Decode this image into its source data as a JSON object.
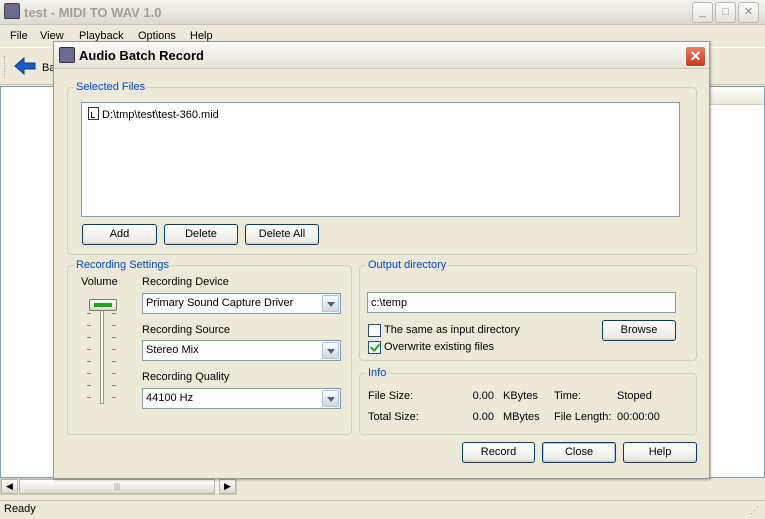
{
  "main_window": {
    "title": "test - MIDI TO WAV 1.0",
    "menu": [
      "File",
      "View",
      "Playback",
      "Options",
      "Help"
    ],
    "toolbar_back_label": "Ba",
    "status": "Ready",
    "scroll_grip": "|||"
  },
  "dialog": {
    "title": "Audio Batch Record",
    "close_glyph": "✕",
    "selected_files": {
      "legend": "Selected Files",
      "files": [
        "D:\\tmp\\test\\test-360.mid"
      ],
      "add_label": "Add",
      "delete_label": "Delete",
      "delete_all_label": "Delete All"
    },
    "recording_settings": {
      "legend": "Recording Settings",
      "volume_label": "Volume",
      "volume_level": 1.0,
      "device_label": "Recording Device",
      "device_value": "Primary Sound Capture Driver",
      "source_label": "Recording Source",
      "source_value": "Stereo Mix",
      "quality_label": "Recording Quality",
      "quality_value": "44100 Hz"
    },
    "output_directory": {
      "legend": "Output directory",
      "path": "c:\\temp",
      "same_as_input_label": "The same as input directory",
      "same_as_input_checked": false,
      "overwrite_label": "Overwrite existing files",
      "overwrite_checked": true,
      "browse_label": "Browse"
    },
    "info": {
      "legend": "Info",
      "file_size_label": "File Size:",
      "file_size_value": "0.00",
      "file_size_unit": "KBytes",
      "total_size_label": "Total Size:",
      "total_size_value": "0.00",
      "total_size_unit": "MBytes",
      "time_label": "Time:",
      "time_value": "Stoped",
      "file_length_label": "File Length:",
      "file_length_value": "00:00:00"
    },
    "record_label": "Record",
    "close_label": "Close",
    "help_label": "Help"
  },
  "colors": {
    "legend_blue": "#0046d5",
    "close_red": "#c5391a",
    "check_green": "#21a121"
  }
}
